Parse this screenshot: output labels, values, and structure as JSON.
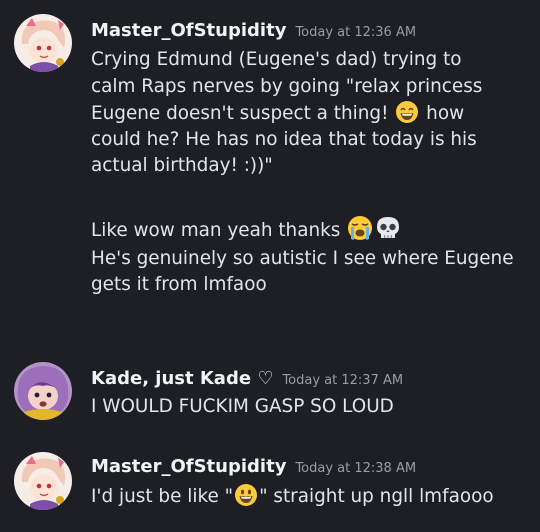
{
  "messages": [
    {
      "username": "Master_OfStupidity",
      "timestamp": "Today at 12:36 AM",
      "lines": [
        "Crying Edmund (Eugene's dad) trying to",
        "calm Raps nerves by going \"relax princess",
        "Eugene doesn't suspect a thing!",
        "how",
        "could he? He has no idea that today is his",
        "actual birthday! :))\"",
        "Like wow man yeah thanks",
        "He's genuinely so autistic I see where Eugene",
        "gets it from lmfaoo"
      ],
      "emojis": [
        "grinning-face-with-smiling-eyes",
        "loudly-crying-face",
        "skull"
      ]
    },
    {
      "username": "Kade, just Kade ♡",
      "timestamp": "Today at 12:37 AM",
      "lines": [
        "I WOULD FUCKIM GASP SO LOUD"
      ]
    },
    {
      "username": "Master_OfStupidity",
      "timestamp": "Today at 12:38 AM",
      "lines": [
        "I'd just be like \"",
        "\" straight up ngll lmfaooo"
      ],
      "emojis": [
        "grinning-face"
      ]
    }
  ],
  "colors": {
    "background": "#1e1f24",
    "text": "#e3e5e8",
    "username": "#f2f3f5",
    "timestamp": "#9a9ca3"
  }
}
